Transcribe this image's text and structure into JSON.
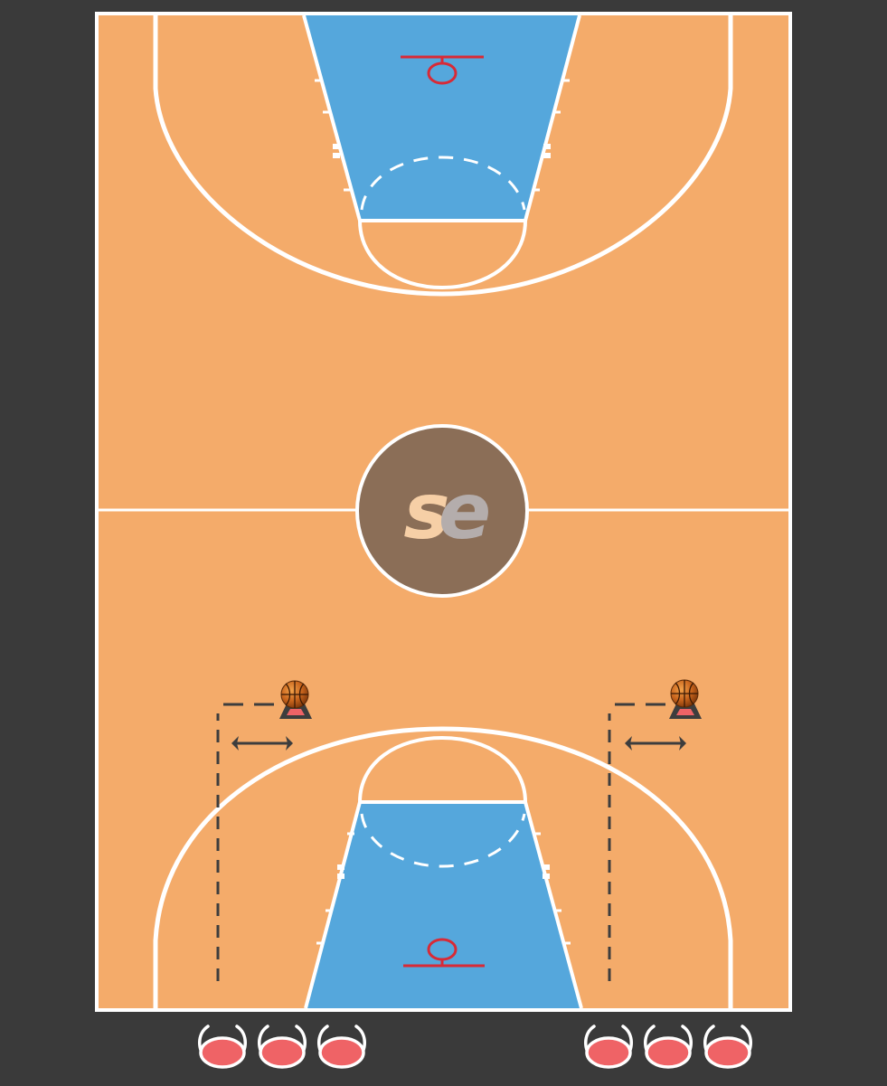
{
  "logo": {
    "text_s": "s",
    "text_e": "e"
  },
  "colors": {
    "background": "#3a3a3a",
    "court": "#f4ab6a",
    "paint": "#55a7dc",
    "lines": "#ffffff",
    "rim": "#d82a36",
    "center_circle": "#8b6e57",
    "logo_s": "#f6cfa6",
    "logo_e": "#b4adac",
    "player": "#ef6366",
    "cone": "#3d3d3d",
    "arrows": "#3d3d3d"
  },
  "icons": {
    "player": "player-icon",
    "ball": "basketball-icon",
    "cone": "cone-icon",
    "arrow": "double-arrow-icon"
  }
}
